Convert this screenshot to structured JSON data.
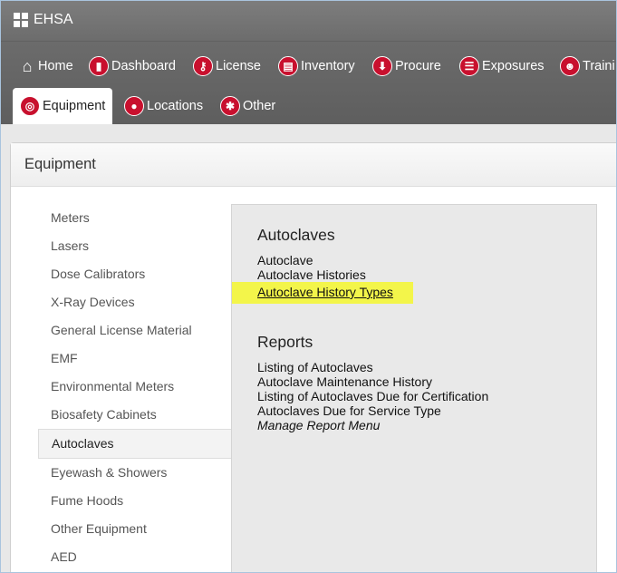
{
  "app": {
    "title": "EHSA"
  },
  "nav": {
    "row1": [
      {
        "label": "Home",
        "icon": "home-icon"
      },
      {
        "label": "Dashboard",
        "icon": "dashboard-icon"
      },
      {
        "label": "License",
        "icon": "key-icon"
      },
      {
        "label": "Inventory",
        "icon": "inventory-icon"
      },
      {
        "label": "Procure",
        "icon": "download-arrow-icon"
      },
      {
        "label": "Exposures",
        "icon": "clipboard-icon"
      },
      {
        "label": "Traini",
        "icon": "training-icon"
      }
    ],
    "row2": [
      {
        "label": "Equipment",
        "icon": "target-icon",
        "active": true
      },
      {
        "label": "Locations",
        "icon": "location-pin-icon"
      },
      {
        "label": "Other",
        "icon": "asterisk-icon"
      }
    ]
  },
  "panel": {
    "title": "Equipment"
  },
  "sidebar": {
    "items": [
      {
        "label": "Meters"
      },
      {
        "label": "Lasers"
      },
      {
        "label": "Dose Calibrators"
      },
      {
        "label": "X-Ray Devices"
      },
      {
        "label": "General License Material"
      },
      {
        "label": "EMF"
      },
      {
        "label": "Environmental Meters"
      },
      {
        "label": "Biosafety Cabinets"
      },
      {
        "label": "Autoclaves",
        "active": true
      },
      {
        "label": "Eyewash & Showers"
      },
      {
        "label": "Fume Hoods"
      },
      {
        "label": "Other Equipment"
      },
      {
        "label": "AED"
      }
    ]
  },
  "content": {
    "section1": {
      "title": "Autoclaves",
      "links": [
        "Autoclave",
        "Autoclave Histories",
        "Autoclave History Types"
      ]
    },
    "section2": {
      "title": "Reports",
      "links": [
        "Listing of Autoclaves",
        "Autoclave Maintenance History",
        "Listing of Autoclaves Due for Certification",
        "Autoclaves Due for Service Type",
        "Manage Report Menu"
      ]
    }
  },
  "colors": {
    "accent": "#c8102e",
    "highlight": "#f3f54a",
    "topbar": "#6b6b6b"
  }
}
